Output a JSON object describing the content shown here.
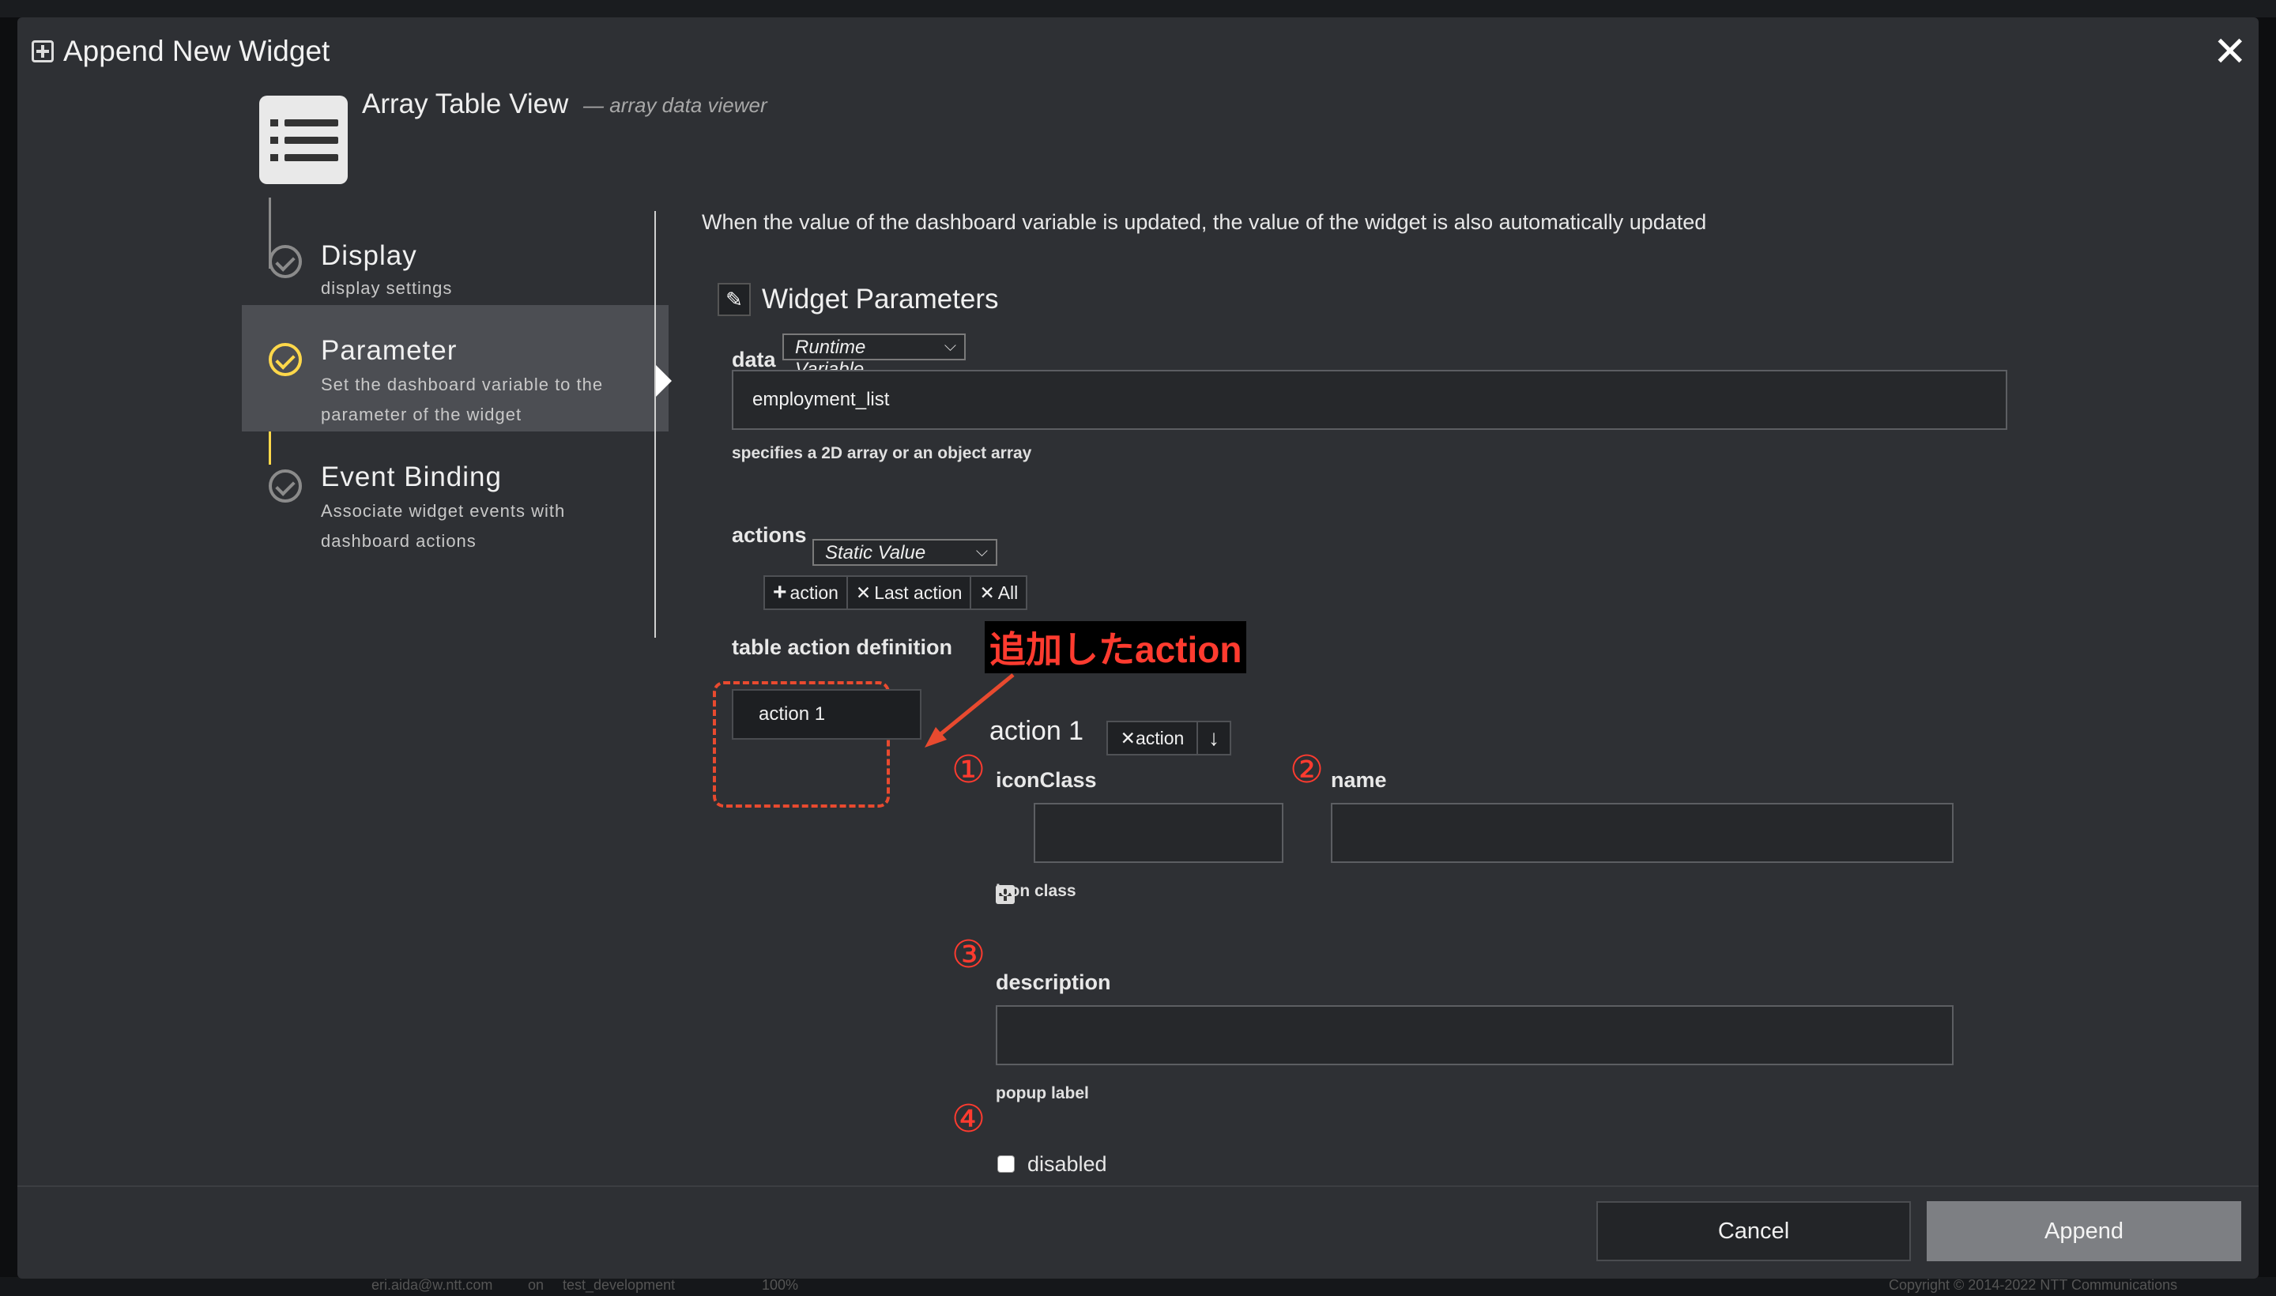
{
  "modal": {
    "title": "Append New Widget",
    "close": "✕"
  },
  "widget": {
    "name": "Array Table View",
    "description": "— array data viewer"
  },
  "steps": [
    {
      "title": "Display",
      "subtitle": "display settings"
    },
    {
      "title": "Parameter",
      "subtitle": "Set the dashboard variable to the parameter of the widget"
    },
    {
      "title": "Event Binding",
      "subtitle": "Associate widget events with dashboard actions"
    }
  ],
  "main": {
    "info": "When the value of the dashboard variable is updated, the value of the widget is also automatically updated",
    "section_title": "Widget Parameters",
    "data": {
      "label": "data",
      "mode": "Runtime Variable",
      "value": "employment_list",
      "hint": "specifies a 2D array or an object array"
    },
    "actions": {
      "label": "actions",
      "mode": "Static Value",
      "buttons": {
        "add": "action",
        "remove_last": "Last action",
        "remove_all": "All"
      },
      "definition_label": "table action definition",
      "items": [
        "action 1"
      ]
    },
    "annotation": "追加したaction",
    "action_detail": {
      "title": "action 1",
      "delete_label": "action",
      "markers": [
        "①",
        "②",
        "③",
        "④"
      ],
      "iconClass": {
        "label": "iconClass",
        "value": "",
        "hint": "icon class"
      },
      "name": {
        "label": "name",
        "value": ""
      },
      "description": {
        "label": "description",
        "value": "",
        "hint": "popup label"
      },
      "disabled": {
        "label": "disabled",
        "checked": false
      }
    }
  },
  "footer": {
    "cancel": "Cancel",
    "append": "Append"
  },
  "background_status": {
    "user": "eri.aida@w.ntt.com",
    "on": "on",
    "project": "test_development",
    "zoom": "100%",
    "copyright": "Copyright © 2014-2022 NTT Communications"
  },
  "colors": {
    "modal_bg": "#2e3034",
    "active_step": "#4c4e53",
    "accent_yellow": "#ffd84a",
    "annotation_red": "#ff3b2f",
    "append_button": "#7d7f83"
  }
}
